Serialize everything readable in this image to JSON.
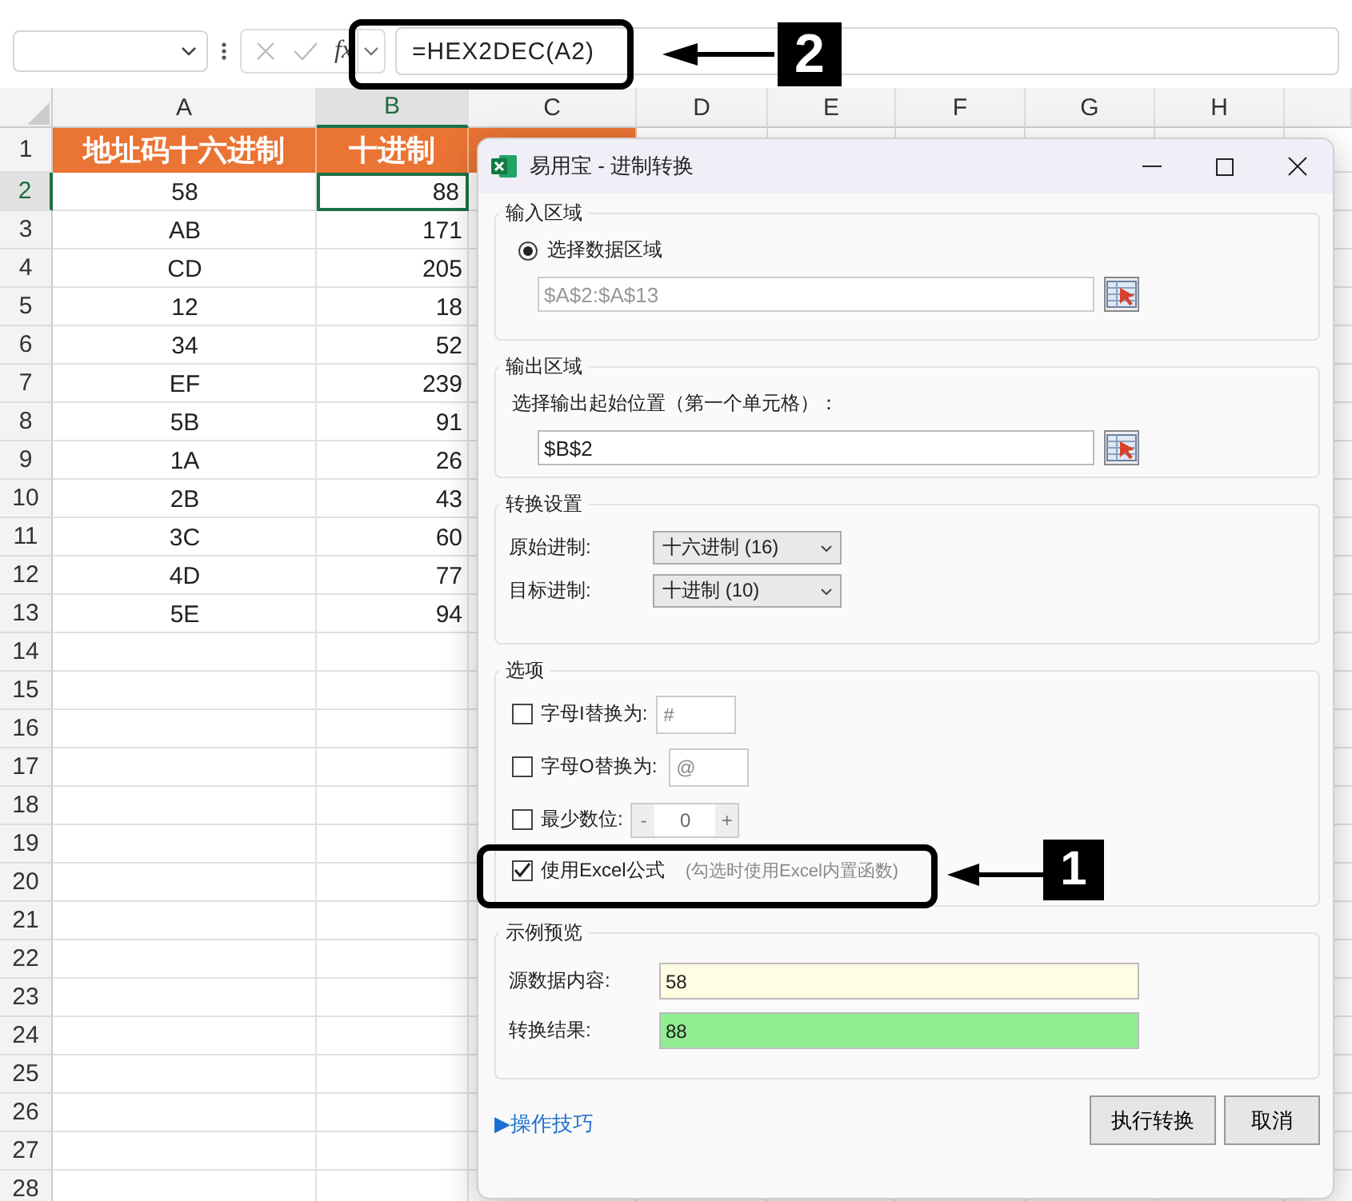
{
  "formula_bar": {
    "function_label": "fx",
    "formula": "=HEX2DEC(A2)"
  },
  "columns": [
    {
      "label": "A",
      "selected": false
    },
    {
      "label": "B",
      "selected": true
    },
    {
      "label": "C",
      "selected": false
    },
    {
      "label": "D",
      "selected": false
    },
    {
      "label": "E",
      "selected": false
    },
    {
      "label": "F",
      "selected": false
    },
    {
      "label": "G",
      "selected": false
    },
    {
      "label": "H",
      "selected": false
    }
  ],
  "rows": [
    {
      "number": "1",
      "kind": "header",
      "selected": false,
      "cells": [
        "地址码十六进制",
        "十进制"
      ]
    },
    {
      "number": "2",
      "kind": "data",
      "selected": true,
      "cells": [
        "58",
        "88"
      ]
    },
    {
      "number": "3",
      "kind": "data",
      "selected": false,
      "cells": [
        "AB",
        "171"
      ]
    },
    {
      "number": "4",
      "kind": "data",
      "selected": false,
      "cells": [
        "CD",
        "205"
      ]
    },
    {
      "number": "5",
      "kind": "data",
      "selected": false,
      "cells": [
        "12",
        "18"
      ]
    },
    {
      "number": "6",
      "kind": "data",
      "selected": false,
      "cells": [
        "34",
        "52"
      ]
    },
    {
      "number": "7",
      "kind": "data",
      "selected": false,
      "cells": [
        "EF",
        "239"
      ]
    },
    {
      "number": "8",
      "kind": "data",
      "selected": false,
      "cells": [
        "5B",
        "91"
      ]
    },
    {
      "number": "9",
      "kind": "data",
      "selected": false,
      "cells": [
        "1A",
        "26"
      ]
    },
    {
      "number": "10",
      "kind": "data",
      "selected": false,
      "cells": [
        "2B",
        "43"
      ]
    },
    {
      "number": "11",
      "kind": "data",
      "selected": false,
      "cells": [
        "3C",
        "60"
      ]
    },
    {
      "number": "12",
      "kind": "data",
      "selected": false,
      "cells": [
        "4D",
        "77"
      ]
    },
    {
      "number": "13",
      "kind": "data",
      "selected": false,
      "cells": [
        "5E",
        "94"
      ]
    },
    {
      "number": "14",
      "kind": "data",
      "selected": false
    },
    {
      "number": "15",
      "kind": "data",
      "selected": false
    },
    {
      "number": "16",
      "kind": "data",
      "selected": false
    },
    {
      "number": "17",
      "kind": "data",
      "selected": false
    },
    {
      "number": "18",
      "kind": "data",
      "selected": false
    },
    {
      "number": "19",
      "kind": "data",
      "selected": false
    },
    {
      "number": "20",
      "kind": "data",
      "selected": false
    },
    {
      "number": "21",
      "kind": "data",
      "selected": false
    },
    {
      "number": "22",
      "kind": "data",
      "selected": false
    },
    {
      "number": "23",
      "kind": "data",
      "selected": false
    },
    {
      "number": "24",
      "kind": "data",
      "selected": false
    },
    {
      "number": "25",
      "kind": "data",
      "selected": false
    },
    {
      "number": "26",
      "kind": "data",
      "selected": false
    },
    {
      "number": "27",
      "kind": "data",
      "selected": false
    },
    {
      "number": "28",
      "kind": "data",
      "selected": false
    }
  ],
  "dialog": {
    "title": "易用宝 - 进制转换",
    "input_area": {
      "title": "输入区域",
      "radio": {
        "label": "选择数据区域",
        "selected": true
      },
      "range_field": {
        "value": "$A$2:$A$13",
        "disabled": true
      }
    },
    "output_area": {
      "title": "输出区域",
      "prompt": "选择输出起始位置（第一个单元格）：",
      "range_field": {
        "value": "$B$2",
        "disabled": false
      }
    },
    "conversion": {
      "title": "转换设置",
      "dropdowns": [
        {
          "label": "原始进制:",
          "value": "十六进制 (16)"
        },
        {
          "label": "目标进制:",
          "value": "十进制 (10)"
        }
      ]
    },
    "options": {
      "title": "选项",
      "items": [
        {
          "kind": "replace",
          "label": "字母I替换为:",
          "checked": false,
          "placeholder": "#"
        },
        {
          "kind": "replace",
          "label": "字母O替换为:",
          "checked": false,
          "placeholder": "@"
        },
        {
          "kind": "stepper",
          "label": "最少数位:",
          "checked": false,
          "minus": "-",
          "value": "0",
          "plus": "+"
        },
        {
          "kind": "plain",
          "label": "使用Excel公式",
          "checked": true,
          "hint": "(勾选时使用Excel内置函数)"
        }
      ]
    },
    "preview": {
      "title": "示例预览",
      "fields": [
        {
          "kind": "source",
          "label": "源数据内容:",
          "value": "58"
        },
        {
          "kind": "result",
          "label": "转换结果:",
          "value": "88"
        }
      ]
    },
    "tips_link": "▶操作技巧",
    "buttons": [
      "执行转换",
      "取消"
    ]
  },
  "annotations": [
    {
      "label": "2"
    },
    {
      "label": "1"
    }
  ]
}
